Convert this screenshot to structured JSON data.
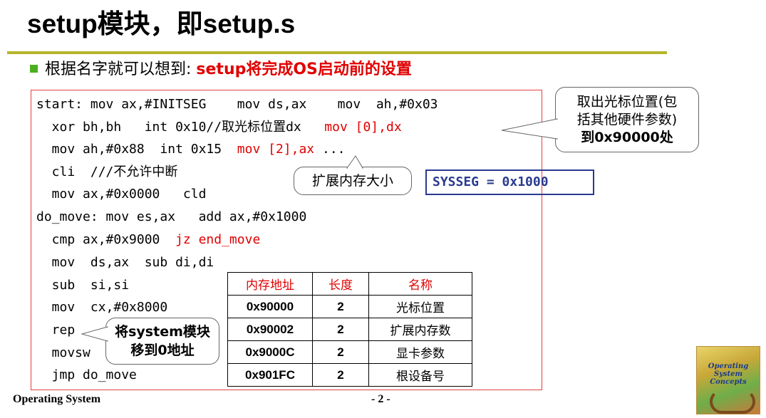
{
  "slide": {
    "title": "setup模块，即setup.s",
    "bullet": {
      "lead": "根据名字就可以想到: ",
      "highlight": "setup将完成OS启动前的设置"
    }
  },
  "code": {
    "line1": {
      "a": "start: mov ax,#INITSEG    mov ds,ax    mov  ah,#0x03"
    },
    "line2": {
      "a": "  xor bh,bh   int 0x10//",
      "cjk": "取光标位置",
      "b": "dx   ",
      "red": "mov [0],dx"
    },
    "line3": {
      "a": "  mov ah,#0x88  int 0x15  ",
      "red": "mov [2],ax",
      "b": " ..."
    },
    "line4": {
      "a": "  cli  ///",
      "cjk": "不允许中断"
    },
    "line5": {
      "a": "  mov ax,#0x0000   cld"
    },
    "line6": {
      "a": "do_move: mov es,ax   add ax,#0x1000"
    },
    "line7": {
      "a": "  cmp ax,#0x9000  ",
      "red": "jz end_move"
    },
    "line8": {
      "a": "  mov  ds,ax  sub di,di"
    },
    "line9": {
      "a": "  sub  si,si"
    },
    "line10": {
      "a": "  mov  cx,#0x8000"
    },
    "line11": {
      "a": "  rep"
    },
    "line12": {
      "a": "  movsw"
    },
    "line13": {
      "a": "  jmp do_move"
    }
  },
  "callouts": {
    "cursor": {
      "line1": "取出光标位置(包",
      "line2": "括其他硬件参数)",
      "line3": "到0x90000处"
    },
    "extmem": "扩展内存大小",
    "system": {
      "line1": "将system模块",
      "line2": "移到0地址"
    }
  },
  "sysseg": "SYSSEG = 0x1000",
  "memory_table": {
    "headers": [
      "内存地址",
      "长度",
      "名称"
    ],
    "rows": [
      [
        "0x90000",
        "2",
        "光标位置"
      ],
      [
        "0x90002",
        "2",
        "扩展内存数"
      ],
      [
        "0x9000C",
        "2",
        "显卡参数"
      ],
      [
        "0x901FC",
        "2",
        "根设备号"
      ]
    ]
  },
  "footer": {
    "left": "Operating System",
    "page": "- 2 -"
  },
  "book_cover": {
    "text1": "Operating",
    "text2": "System",
    "text3": "Concepts"
  },
  "colors": {
    "accent_red": "#e00000",
    "rule": "#b5b52c",
    "bullet": "#4caf1e",
    "sysseg_blue": "#2a3a8f"
  }
}
